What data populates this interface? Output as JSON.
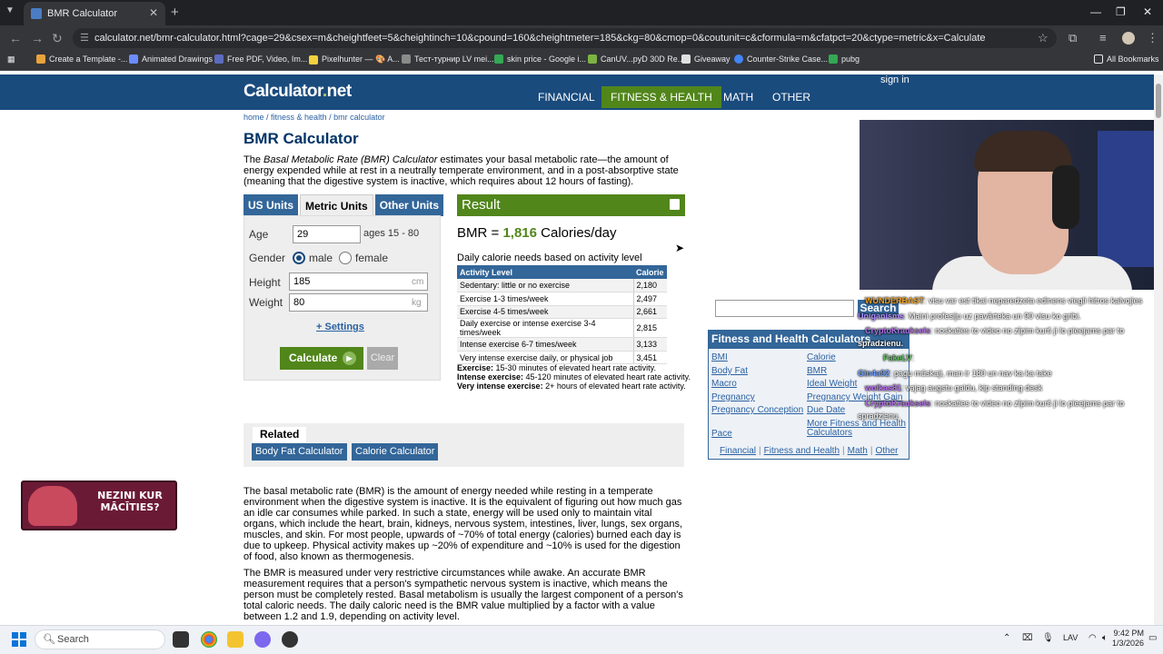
{
  "browser": {
    "tab_title": "BMR Calculator",
    "url": "calculator.net/bmr-calculator.html?cage=29&csex=m&cheightfeet=5&cheightinch=10&cpound=160&cheightmeter=185&ckg=80&cmop=0&coutunit=c&cformula=m&cfatpct=20&ctype=metric&x=Calculate",
    "bookmarks": [
      "Create a Template -...",
      "Animated Drawings",
      "Free PDF, Video, Im...",
      "Pixelhunter — 🎨 A...",
      "Тест-турнир LV mei...",
      "skin price - Google i...",
      "CanUV...pyD 30D Re...",
      "Giveaway",
      "Counter-Strike Case...",
      "pubg"
    ],
    "all_bookmarks": "All Bookmarks"
  },
  "site": {
    "logo_main": "Calculator",
    "logo_dot": ".",
    "logo_tld": "net",
    "nav": [
      "FINANCIAL",
      "FITNESS & HEALTH",
      "MATH",
      "OTHER"
    ],
    "signin": "sign in"
  },
  "breadcrumb": {
    "home": "home",
    "sep": " / ",
    "section": "fitness & health",
    "page": "bmr calculator"
  },
  "page": {
    "title": "BMR Calculator",
    "intro_pre": "The ",
    "intro_em": "Basal Metabolic Rate (BMR) Calculator",
    "intro_post": " estimates your basal metabolic rate—the amount of energy expended while at rest in a neutrally temperate environment, and in a post-absorptive state (meaning that the digestive system is inactive, which requires about 12 hours of fasting)."
  },
  "form": {
    "tabs": [
      "US Units",
      "Metric Units",
      "Other Units"
    ],
    "age_label": "Age",
    "age_value": "29",
    "age_hint": "ages 15 - 80",
    "gender_label": "Gender",
    "male": "male",
    "female": "female",
    "height_label": "Height",
    "height_value": "185",
    "height_unit": "cm",
    "weight_label": "Weight",
    "weight_value": "80",
    "weight_unit": "kg",
    "settings": "+ Settings",
    "calculate": "Calculate",
    "clear": "Clear"
  },
  "result": {
    "header": "Result",
    "bmr_prefix": "BMR = ",
    "bmr_value": "1,816",
    "bmr_suffix": " Calories/day",
    "daily_needs": "Daily calorie needs based on activity level",
    "col_activity": "Activity Level",
    "col_calorie": "Calorie",
    "rows": [
      {
        "activity": "Sedentary: little or no exercise",
        "calorie": "2,180"
      },
      {
        "activity": "Exercise 1-3 times/week",
        "calorie": "2,497"
      },
      {
        "activity": "Exercise 4-5 times/week",
        "calorie": "2,661"
      },
      {
        "activity": "Daily exercise or intense exercise 3-4 times/week",
        "calorie": "2,815"
      },
      {
        "activity": "Intense exercise 6-7 times/week",
        "calorie": "3,133"
      },
      {
        "activity": "Very intense exercise daily, or physical job",
        "calorie": "3,451"
      }
    ],
    "def1_b": "Exercise:",
    "def1": " 15-30 minutes of elevated heart rate activity.",
    "def2_b": "Intense exercise:",
    "def2": " 45-120 minutes of elevated heart rate activity.",
    "def3_b": "Very intense exercise:",
    "def3": " 2+ hours of elevated heart rate activity."
  },
  "related": {
    "title": "Related",
    "links": [
      "Body Fat Calculator",
      "Calorie Calculator"
    ]
  },
  "article": {
    "p1": "The basal metabolic rate (BMR) is the amount of energy needed while resting in a temperate environment when the digestive system is inactive. It is the equivalent of figuring out how much gas an idle car consumes while parked. In such a state, energy will be used only to maintain vital organs, which include the heart, brain, kidneys, nervous system, intestines, liver, lungs, sex organs, muscles, and skin. For most people, upwards of ~70% of total energy (calories) burned each day is due to upkeep. Physical activity makes up ~20% of expenditure and ~10% is used for the digestion of food, also known as thermogenesis.",
    "p2": "The BMR is measured under very restrictive circumstances while awake. An accurate BMR measurement requires that a person's sympathetic nervous system is inactive, which means the person must be completely rested. Basal metabolism is usually the largest component of a person's total caloric needs. The daily caloric need is the BMR value multiplied by a factor with a value between 1.2 and 1.9, depending on activity level."
  },
  "promo": {
    "line1": "NEZINI KUR",
    "line2": "MĀCĪTIES?"
  },
  "sidebar": {
    "search_button": "Search",
    "panel_title": "Fitness and Health Calculators",
    "left_links": [
      "BMI",
      "Body Fat",
      "Macro",
      "Pregnancy",
      "Pregnancy Conception",
      "Pace"
    ],
    "right_links": [
      "Calorie",
      "BMR",
      "Ideal Weight",
      "Pregnancy Weight Gain",
      "Due Date",
      "More Fitness and Health Calculators"
    ],
    "footer": [
      "Financial",
      "Fitness and Health",
      "Math",
      "Other"
    ],
    "footer_sep": "|"
  },
  "chat": [
    {
      "user": "WUNDERBAST",
      "msg": ": visu var est tikai neparedzeta edinens viegli hitros kalvojies",
      "color": "#f0a020"
    },
    {
      "user": "Uniganisms",
      "msg": ": Maini profesiju uz pavārteka un 90 visu ko gribi.",
      "color": "#b090ff"
    },
    {
      "user": "CryptoKrauksels",
      "msg": ": noskaties to video no zīpim kurš ji lo pieejams par to",
      "color": "#b070e0"
    },
    {
      "user": "spradzienu.",
      "msg": "",
      "color": "#ffffff"
    },
    {
      "user": "FakeLV",
      "msg": ":",
      "color": "#60c060"
    },
    {
      "user": "Gin4a92",
      "msg": ": pagu mūskaji, man ir 180 un nav ka ka take",
      "color": "#70a0ff"
    },
    {
      "user": "wolkas81",
      "msg": ": vajag augstu galdu, kip standing desk",
      "color": "#c070ff"
    },
    {
      "user": "CryptoKrauksels",
      "msg": ": noskaties to video no zīpim kurš ji lo pieejams par to",
      "color": "#b070e0"
    },
    {
      "user": "",
      "msg": "spradzienu.",
      "color": "#ffffff"
    }
  ],
  "taskbar": {
    "search": "Search",
    "lang": "LAV",
    "time": "9:42 PM",
    "date": "1/3/2026"
  }
}
